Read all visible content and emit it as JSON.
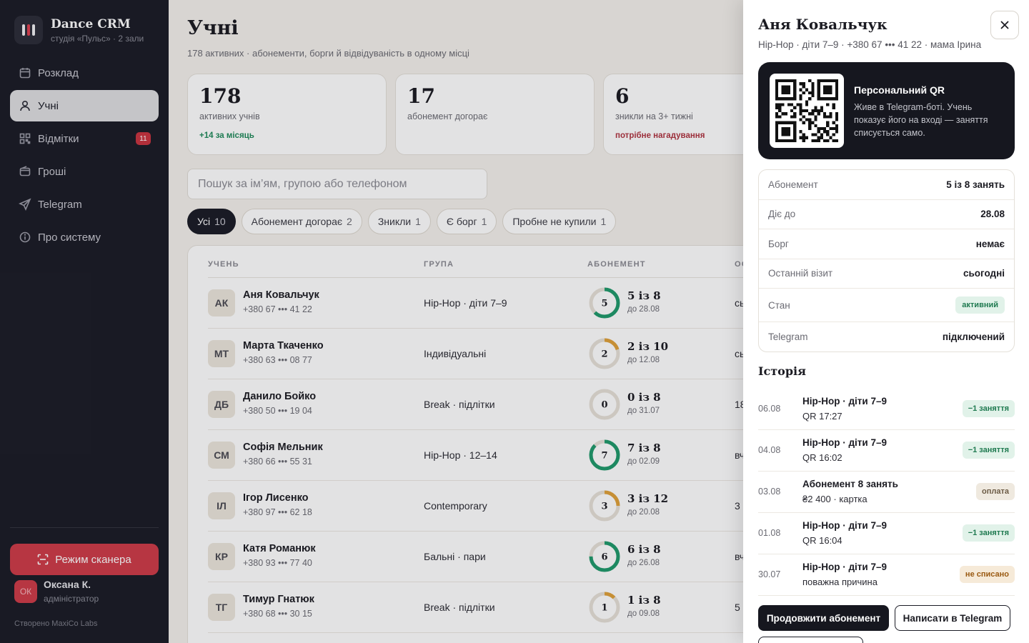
{
  "sidebar": {
    "brand_name": "Dance CRM",
    "brand_sub": "студія «Пульс» · 2 зали",
    "nav": [
      {
        "label": "Розклад",
        "icon": "calendar-icon"
      },
      {
        "label": "Учні",
        "icon": "user-icon",
        "active": true
      },
      {
        "label": "Відмітки",
        "icon": "qr-grid-icon",
        "badge": "11"
      },
      {
        "label": "Гроші",
        "icon": "wallet-icon"
      },
      {
        "label": "Telegram",
        "icon": "send-icon"
      },
      {
        "label": "Про систему",
        "icon": "info-icon"
      }
    ],
    "scanner_label": "Режим сканера",
    "user": {
      "initials": "ОК",
      "name": "Оксана К.",
      "role": "адміністратор"
    },
    "credit": "Створено MaxiCo Labs"
  },
  "main": {
    "title": "Учні",
    "subtitle": "178 активних · абонементи, борги й відвідуваність в одному місці",
    "stats": [
      {
        "value": "178",
        "label": "активних учнів",
        "hint": "+14 за місяць",
        "tone": "green"
      },
      {
        "value": "17",
        "label": "абонемент догорає",
        "hint": "",
        "tone": ""
      },
      {
        "value": "6",
        "label": "зникли на 3+ тижні",
        "hint": "потрібне нагадування",
        "tone": "red"
      }
    ],
    "search_placeholder": "Пошук за ім’ям, групою або телефоном",
    "filters": [
      {
        "label": "Усі",
        "count": "10",
        "active": true
      },
      {
        "label": "Абонемент догорає",
        "count": "2"
      },
      {
        "label": "Зникли",
        "count": "1"
      },
      {
        "label": "Є борг",
        "count": "1"
      },
      {
        "label": "Пробне не купили",
        "count": "1"
      }
    ],
    "columns": [
      "УЧЕНЬ",
      "ГРУПА",
      "АБОНЕМЕНТ",
      "ОС"
    ],
    "rows": [
      {
        "initials": "АК",
        "name": "Аня Ковальчук",
        "phone": "+380 67 ••• 41 22",
        "group": "Hip-Hop · діти 7–9",
        "used": 5,
        "total": 8,
        "ring_label": "5",
        "abonement": "5 із 8",
        "till": "до 28.08",
        "last": "сь"
      },
      {
        "initials": "МТ",
        "name": "Марта Ткаченко",
        "phone": "+380 63 ••• 08 77",
        "group": "Індивідуальні",
        "used": 2,
        "total": 10,
        "ring_label": "2",
        "abonement": "2 із 10",
        "till": "до 12.08",
        "last": "сь"
      },
      {
        "initials": "ДБ",
        "name": "Данило Бойко",
        "phone": "+380 50 ••• 19 04",
        "group": "Break · підлітки",
        "used": 0,
        "total": 8,
        "ring_label": "0",
        "abonement": "0 із 8",
        "till": "до 31.07",
        "last": "18"
      },
      {
        "initials": "СМ",
        "name": "Софія Мельник",
        "phone": "+380 66 ••• 55 31",
        "group": "Hip-Hop · 12–14",
        "used": 7,
        "total": 8,
        "ring_label": "7",
        "abonement": "7 із 8",
        "till": "до 02.09",
        "last": "вч"
      },
      {
        "initials": "ІЛ",
        "name": "Ігор Лисенко",
        "phone": "+380 97 ••• 62 18",
        "group": "Contemporary",
        "used": 3,
        "total": 12,
        "ring_label": "3",
        "abonement": "3 із 12",
        "till": "до 20.08",
        "last": "3"
      },
      {
        "initials": "КР",
        "name": "Катя Романюк",
        "phone": "+380 93 ••• 77 40",
        "group": "Бальні · пари",
        "used": 6,
        "total": 8,
        "ring_label": "6",
        "abonement": "6 із 8",
        "till": "до 26.08",
        "last": "вч"
      },
      {
        "initials": "ТГ",
        "name": "Тимур Гнатюк",
        "phone": "+380 68 ••• 30 15",
        "group": "Break · підлітки",
        "used": 1,
        "total": 8,
        "ring_label": "1",
        "abonement": "1 із 8",
        "till": "до 09.08",
        "last": "5"
      }
    ]
  },
  "drawer": {
    "name": "Аня Ковальчук",
    "meta": "Hip-Hop · діти 7–9 · +380 67 ••• 41 22 · мама Ірина",
    "qr_title": "Персональний QR",
    "qr_desc": "Живе в Telegram-боті. Учень показує його на вході — заняття списується само.",
    "info": [
      {
        "key": "Абонемент",
        "value": "5 із 8 занять"
      },
      {
        "key": "Діє до",
        "value": "28.08"
      },
      {
        "key": "Борг",
        "value": "немає"
      },
      {
        "key": "Останній візит",
        "value": "сьогодні"
      },
      {
        "key": "Стан",
        "value": "активний",
        "pill": true
      },
      {
        "key": "Telegram",
        "value": "підключений"
      }
    ],
    "history_title": "Історія",
    "history": [
      {
        "date": "06.08",
        "title": "Hip-Hop · діти 7–9",
        "sub": "QR 17:27",
        "tag": "−1 заняття",
        "tone": "green"
      },
      {
        "date": "04.08",
        "title": "Hip-Hop · діти 7–9",
        "sub": "QR 16:02",
        "tag": "−1 заняття",
        "tone": "green"
      },
      {
        "date": "03.08",
        "title": "Абонемент 8 занять",
        "sub": "₴2 400 · картка",
        "tag": "оплата",
        "tone": "beige"
      },
      {
        "date": "01.08",
        "title": "Hip-Hop · діти 7–9",
        "sub": "QR 16:04",
        "tag": "−1 заняття",
        "tone": "green"
      },
      {
        "date": "30.07",
        "title": "Hip-Hop · діти 7–9",
        "sub": "поважна причина",
        "tag": "не списано",
        "tone": "amber"
      }
    ],
    "extend_label": "Продовжити абонемент",
    "telegram_label": "Написати в Telegram"
  },
  "colors": {
    "accent_red": "#cf3c48",
    "ring_green": "#1f9a6c",
    "ring_amber": "#e0a13a",
    "ring_track": "#e6e1d8",
    "sidebar_bg": "#1b1c26"
  }
}
